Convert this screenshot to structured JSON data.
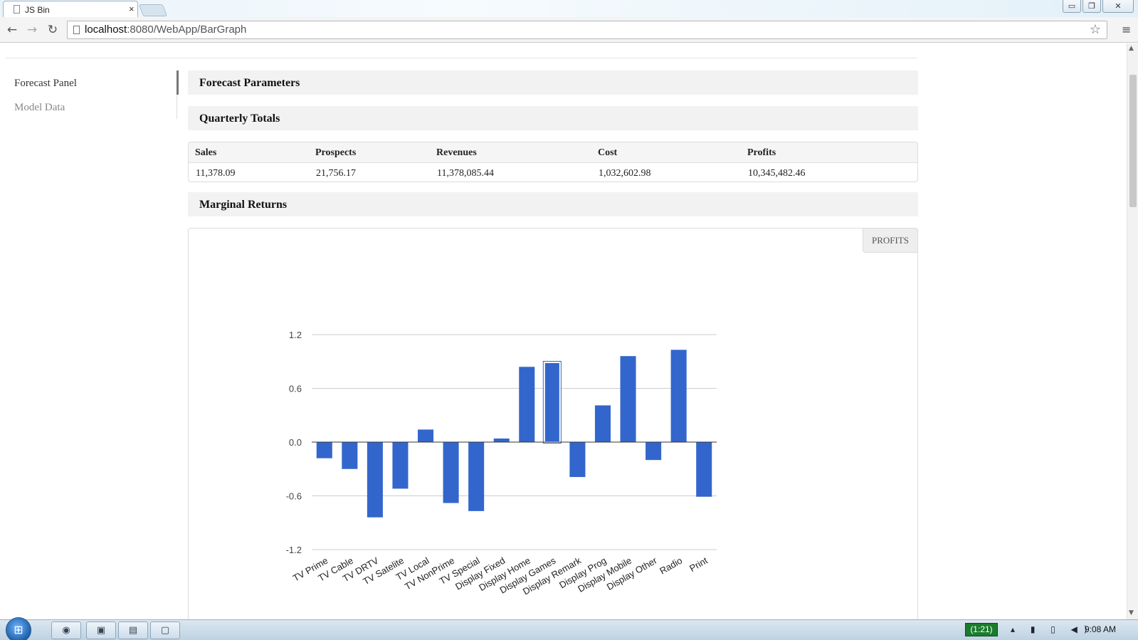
{
  "browser": {
    "tab_title": "JS Bin",
    "tab_close": "×",
    "url_host": "localhost",
    "url_rest": ":8080/WebApp/BarGraph",
    "back_icon": "←",
    "forward_icon": "→",
    "reload_icon": "↻",
    "star_icon": "☆",
    "menu_icon": "≡",
    "win_minimize": "▭",
    "win_maximize": "❐",
    "win_close": "✕"
  },
  "sidenav": {
    "items": [
      {
        "label": "Forecast Panel",
        "active": true
      },
      {
        "label": "Model Data",
        "active": false
      }
    ]
  },
  "sections": {
    "forecast_parameters": "Forecast Parameters",
    "quarterly_totals": "Quarterly Totals",
    "marginal_returns": "Marginal Returns"
  },
  "totals": {
    "headers": [
      "Sales",
      "Prospects",
      "Revenues",
      "Cost",
      "Profits"
    ],
    "values": [
      "11,378.09",
      "21,756.17",
      "11,378,085.44",
      "1,032,602.98",
      "10,345,482.46"
    ]
  },
  "chart_toggle": "PROFITS",
  "chart_data": {
    "type": "bar",
    "bar_color": "#3366cc",
    "categories": [
      "TV Prime",
      "TV Cable",
      "TV DRTV",
      "TV Satelite",
      "TV Local",
      "TV NonPrime",
      "TV Special",
      "Display Fixed",
      "Display Home",
      "Display Games",
      "Display Remark",
      "Display Prog",
      "Display Mobile",
      "Display Other",
      "Radio",
      "Print"
    ],
    "values": [
      -0.18,
      -0.3,
      -0.84,
      -0.52,
      0.14,
      -0.68,
      -0.77,
      0.04,
      0.84,
      0.89,
      -0.39,
      0.41,
      0.96,
      -0.2,
      1.03,
      -0.61
    ],
    "highlighted_category": "Display Games",
    "ylim": [
      -1.2,
      1.2
    ],
    "yticks": [
      1.2,
      0.6,
      0.0,
      -0.6,
      -1.2
    ],
    "ytick_labels": [
      "1.2",
      "0.6",
      "0.0",
      "-0.6",
      "-1.2"
    ],
    "grid": true,
    "title": "",
    "xlabel": "",
    "ylabel": ""
  },
  "taskbar": {
    "start_icon": "⊞",
    "apps": [
      "◉",
      "▣",
      "▤",
      "▢"
    ],
    "battery": "(1:21)",
    "tray": "▴ ▮ ▯ ◀)",
    "clock": "9:08 AM"
  }
}
